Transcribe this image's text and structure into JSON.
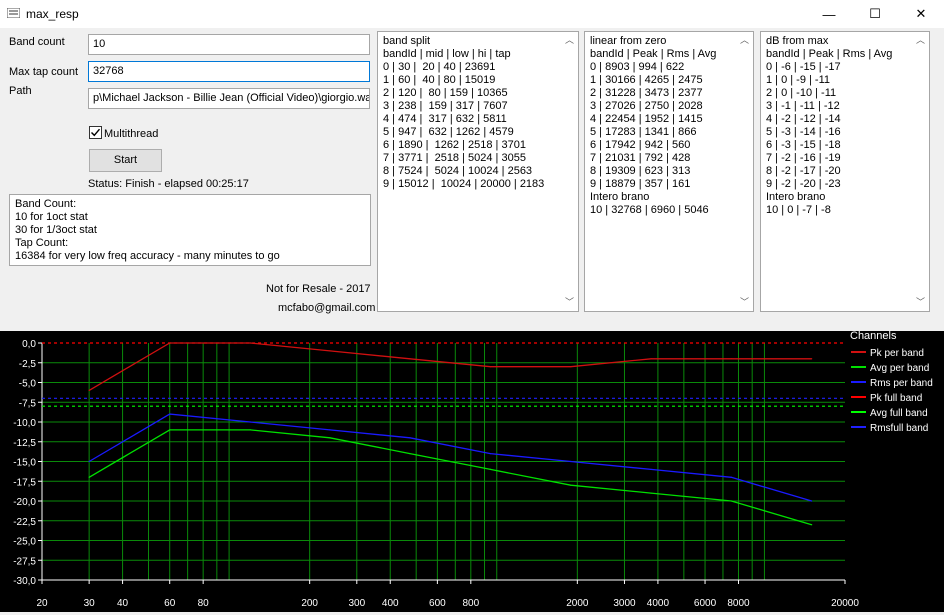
{
  "window": {
    "title": "max_resp",
    "minimize": "—",
    "maximize": "☐",
    "close": "✕"
  },
  "form": {
    "band_count_label": "Band count",
    "band_count_value": "10",
    "max_tap_label": "Max tap count",
    "max_tap_value": "32768",
    "path_label": "Path",
    "path_value": "p\\Michael Jackson - Billie Jean (Official Video)\\giorgio.wav",
    "multithread_label": "Multithread",
    "multithread_checked": true,
    "start_label": "Start",
    "status": "Status: Finish - elapsed 00:25:17",
    "help_lines": [
      "Band Count:",
      "10 for 1oct stat",
      "30 for 1/3oct stat",
      "Tap Count:",
      "16384 for very low freq accuracy - many minutes to go"
    ],
    "footer1": "Not for Resale - 2017",
    "footer2": "mcfabo@gmail.com"
  },
  "panels": {
    "band_split": [
      "band split",
      "bandId | mid | low | hi | tap",
      "0 | 30 |  20 | 40 | 23691",
      "1 | 60 |  40 | 80 | 15019",
      "2 | 120 |  80 | 159 | 10365",
      "3 | 238 |  159 | 317 | 7607",
      "4 | 474 |  317 | 632 | 5811",
      "5 | 947 |  632 | 1262 | 4579",
      "6 | 1890 |  1262 | 2518 | 3701",
      "7 | 3771 |  2518 | 5024 | 3055",
      "8 | 7524 |  5024 | 10024 | 2563",
      "9 | 15012 |  10024 | 20000 | 2183"
    ],
    "linear": [
      "linear from zero",
      "bandId | Peak | Rms | Avg",
      "0 | 8903 | 994 | 622",
      "1 | 30166 | 4265 | 2475",
      "2 | 31228 | 3473 | 2377",
      "3 | 27026 | 2750 | 2028",
      "4 | 22454 | 1952 | 1415",
      "5 | 17283 | 1341 | 866",
      "6 | 17942 | 942 | 560",
      "7 | 21031 | 792 | 428",
      "8 | 19309 | 623 | 313",
      "9 | 18879 | 357 | 161",
      "Intero brano",
      "10 | 32768 | 6960 | 5046"
    ],
    "db": [
      "dB from max",
      "bandId | Peak | Rms | Avg",
      "0 | -6 | -15 | -17",
      "1 | 0 | -9 | -11",
      "2 | 0 | -10 | -11",
      "3 | -1 | -11 | -12",
      "4 | -2 | -12 | -14",
      "5 | -3 | -14 | -16",
      "6 | -3 | -15 | -18",
      "7 | -2 | -16 | -19",
      "8 | -2 | -17 | -20",
      "9 | -2 | -20 | -23",
      "Intero brano",
      "10 | 0 | -7 | -8"
    ]
  },
  "chart_data": {
    "type": "line",
    "x_scale": "log",
    "xlim": [
      20,
      20000
    ],
    "ylim": [
      -30,
      0
    ],
    "grid": true,
    "legend_title": "Channels",
    "legend_position": "right",
    "x_ticks": [
      "20",
      "30",
      "40",
      "60",
      "80",
      "200",
      "300",
      "400",
      "600",
      "800",
      "2000",
      "3000",
      "4000",
      "6000",
      "8000",
      "20000"
    ],
    "y_ticks": [
      "0,0",
      "-2,5",
      "-5,0",
      "-7,5",
      "-10,0",
      "-12,5",
      "-15,0",
      "-17,5",
      "-20,0",
      "-22,5",
      "-25,0",
      "-27,5",
      "-30,0"
    ],
    "x": [
      30,
      60,
      120,
      238,
      474,
      947,
      1890,
      3771,
      7524,
      15012
    ],
    "series": [
      {
        "name": "Pk per band",
        "color": "#d01010",
        "values": [
          -6,
          0,
          0,
          -1,
          -2,
          -3,
          -3,
          -2,
          -2,
          -2
        ]
      },
      {
        "name": "Avg per band",
        "color": "#00e000",
        "values": [
          -17,
          -11,
          -11,
          -12,
          -14,
          -16,
          -18,
          -19,
          -20,
          -23
        ]
      },
      {
        "name": "Rms per band",
        "color": "#1a1aff",
        "values": [
          -15,
          -9,
          -10,
          -11,
          -12,
          -14,
          -15,
          -16,
          -17,
          -20
        ]
      },
      {
        "name": "Pk full band",
        "color": "#ff0000",
        "level": 0
      },
      {
        "name": "Avg full band",
        "color": "#00ff00",
        "level": -8
      },
      {
        "name": "Rmsfull band",
        "color": "#2020ff",
        "level": -7
      }
    ]
  }
}
